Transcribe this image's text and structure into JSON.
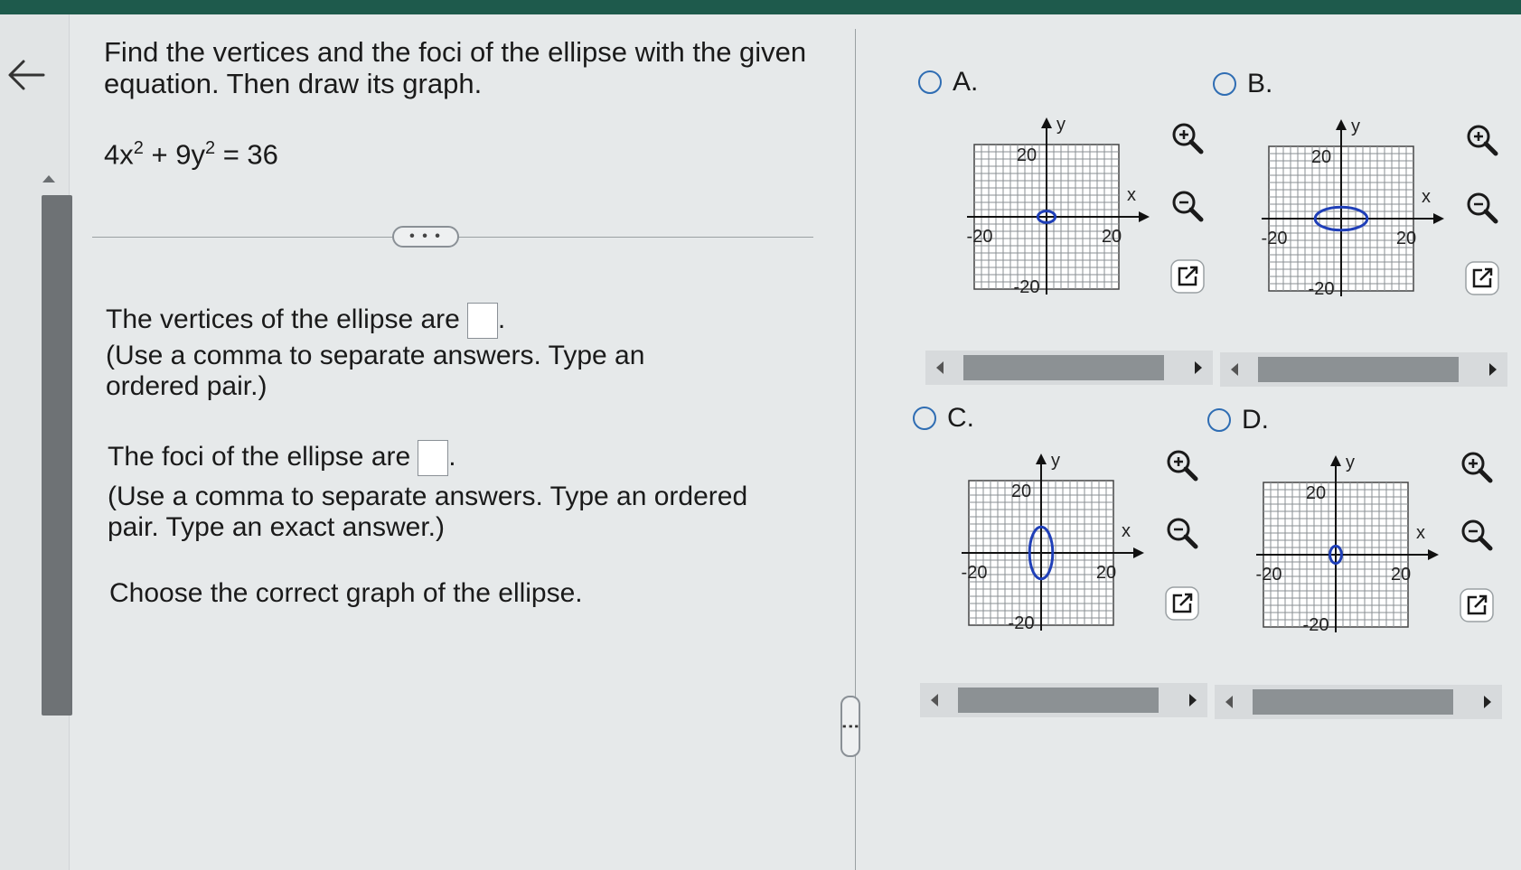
{
  "question": {
    "line1": "Find the vertices and the foci of the ellipse with the given",
    "line2": "equation. Then draw its graph.",
    "equation": {
      "a": "4x",
      "exp1": "2",
      "b": " + 9y",
      "exp2": "2",
      "rhs": " = 36"
    }
  },
  "more_button": "• • •",
  "vertices": {
    "prompt": "The vertices of the ellipse are",
    "end": ".",
    "hint1": "(Use a comma to separate answers. Type an",
    "hint2": "ordered pair.)"
  },
  "foci": {
    "prompt": "The foci of the ellipse are",
    "end": ".",
    "hint1": "(Use a comma to separate answers. Type an ordered",
    "hint2": "pair. Type an exact answer.)"
  },
  "choose": "Choose the correct graph of the ellipse.",
  "split_handle": "⋮",
  "options": [
    {
      "letter": "A.",
      "ellipse": {
        "rx": 3,
        "ry": 2
      }
    },
    {
      "letter": "B.",
      "ellipse": {
        "rx": 9,
        "ry": 4
      }
    },
    {
      "letter": "C.",
      "ellipse": {
        "rx": 4,
        "ry": 9
      }
    },
    {
      "letter": "D.",
      "ellipse": {
        "rx": 2,
        "ry": 3
      }
    }
  ],
  "graph_labels": {
    "x": "x",
    "y": "y",
    "pos": "20",
    "neg": "-20",
    "neg_y": "-20"
  },
  "icons": {
    "zoom_in": "zoom-in-icon",
    "zoom_out": "zoom-out-icon",
    "popout": "external-link-icon"
  },
  "colors": {
    "ellipse": "#1f3fb8",
    "radio": "#2f6db3",
    "topbar": "#1e5a4c"
  }
}
